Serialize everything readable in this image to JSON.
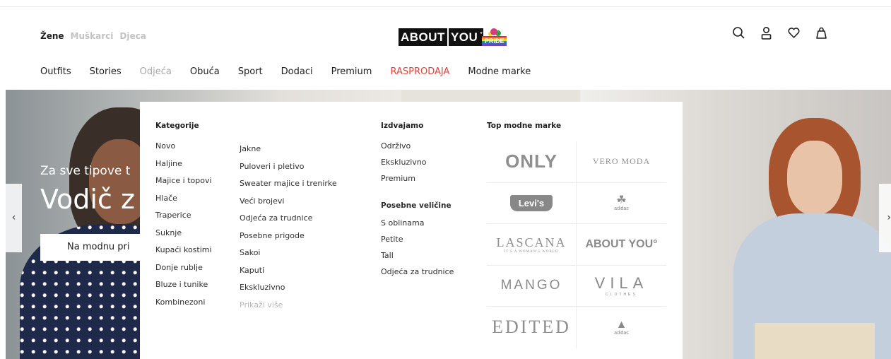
{
  "header": {
    "gender_tabs": [
      {
        "label": "Žene",
        "active": true
      },
      {
        "label": "Muškarci",
        "active": false
      },
      {
        "label": "Djeca",
        "active": false
      }
    ],
    "logo": {
      "part1": "ABOUT",
      "part2": "YOU",
      "badge": "PRIDE"
    },
    "icons": [
      "search-icon",
      "user-icon",
      "heart-icon",
      "bag-icon"
    ]
  },
  "nav": {
    "items": [
      "Outfits",
      "Stories",
      "Odjeća",
      "Obuća",
      "Sport",
      "Dodaci",
      "Premium",
      "RASPRODAJA",
      "Modne marke"
    ]
  },
  "hero": {
    "small_text": "Za sve tipove t",
    "big_text": "Vodič z",
    "button_label": "Na modnu pri",
    "prev_arrow": "‹",
    "next_arrow": "›"
  },
  "dropdown": {
    "categories": {
      "heading": "Kategorije",
      "col1": [
        "Novo",
        "Haljine",
        "Majice i topovi",
        "Hlače",
        "Traperice",
        "Suknje",
        "Kupaći kostimi",
        "Donje rublje",
        "Bluze i tunike",
        "Kombinezoni"
      ],
      "col2": [
        "Jakne",
        "Puloveri i pletivo",
        "Sweater majice i trenirke",
        "Veći brojevi",
        "Odjeća za trudnice",
        "Posebne prigode",
        "Sakoi",
        "Kaputi",
        "Ekskluzivno"
      ],
      "show_more": "Prikaži više"
    },
    "featured": {
      "heading": "Izdvajamo",
      "items": [
        "Održivo",
        "Ekskluzivno",
        "Premium"
      ]
    },
    "special_sizes": {
      "heading": "Posebne veličine",
      "items": [
        "S oblinama",
        "Petite",
        "Tall",
        "Odjeća za trudnice"
      ]
    },
    "top_brands": {
      "heading": "Top modne marke",
      "brands": {
        "only": "ONLY",
        "vero_moda": "VERO MODA",
        "levis": "Levi's",
        "adidas_originals": "adidas",
        "lascana": "LASCANA",
        "lascana_tagline": "IT'S A WOMAN'S WORLD",
        "about_you": "ABOUT YOU°",
        "mango": "MANGO",
        "vila": "VILA",
        "vila_tagline": "CLOTHES",
        "edited": "EDITED",
        "adidas_performance": "adidas"
      }
    }
  },
  "colors": {
    "sale": "#e0453c",
    "muted": "#b8b8b8",
    "text": "#1f1f1f"
  }
}
